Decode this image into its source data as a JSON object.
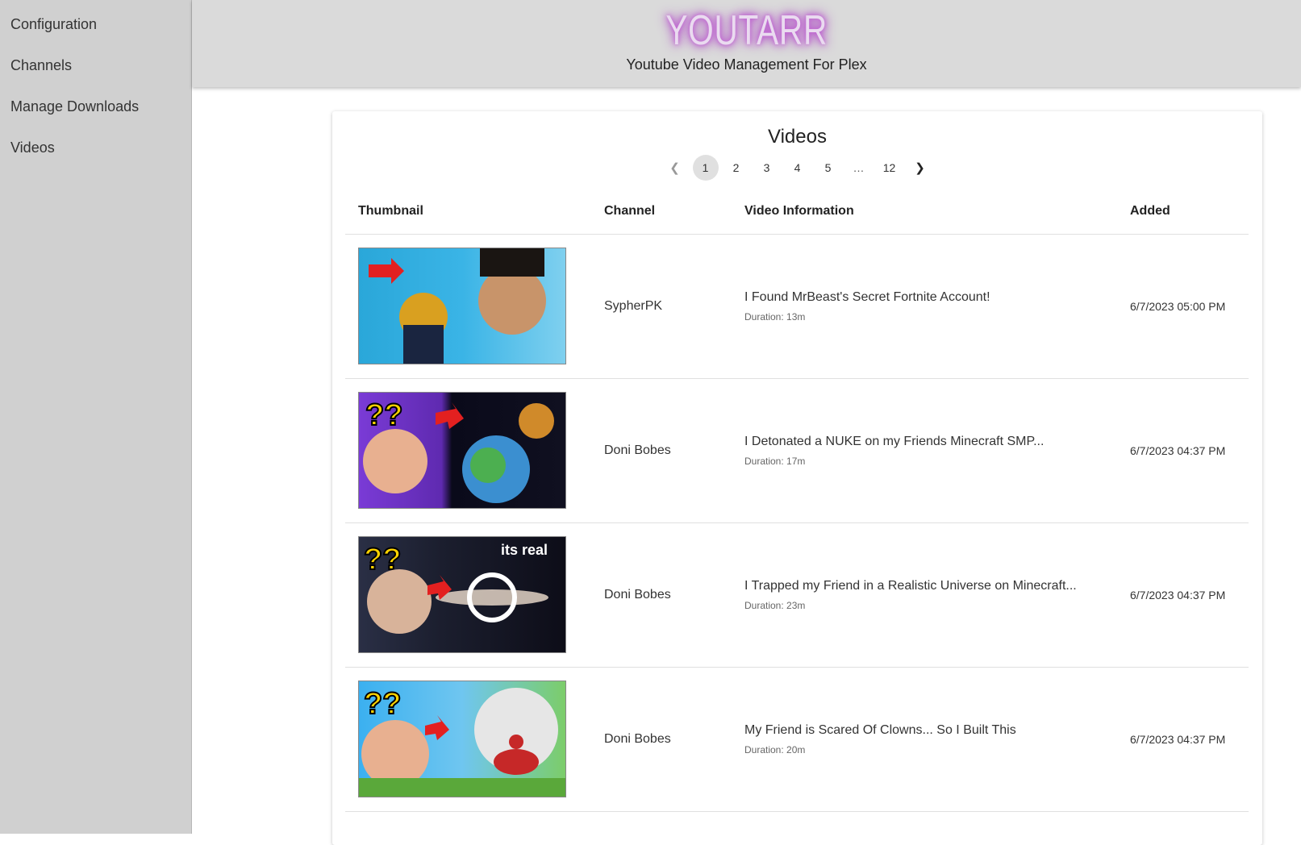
{
  "sidebar": {
    "items": [
      {
        "label": "Configuration"
      },
      {
        "label": "Channels"
      },
      {
        "label": "Manage Downloads"
      },
      {
        "label": "Videos"
      }
    ]
  },
  "header": {
    "brand": "YOUTARR",
    "tagline": "Youtube Video Management For Plex"
  },
  "videos": {
    "title": "Videos",
    "pagination": {
      "prev_icon": "chevron-left-icon",
      "next_icon": "chevron-right-icon",
      "pages": [
        "1",
        "2",
        "3",
        "4",
        "5",
        "…",
        "12"
      ],
      "current": "1"
    },
    "columns": [
      "Thumbnail",
      "Channel",
      "Video Information",
      "Added"
    ],
    "rows": [
      {
        "channel": "SypherPK",
        "title": "I Found MrBeast's Secret Fortnite Account!",
        "duration": "Duration: 13m",
        "added": "6/7/2023 05:00 PM",
        "thumb_text": ""
      },
      {
        "channel": "Doni Bobes",
        "title": "I Detonated a NUKE on my Friends Minecraft SMP...",
        "duration": "Duration: 17m",
        "added": "6/7/2023 04:37 PM",
        "thumb_text": ""
      },
      {
        "channel": "Doni Bobes",
        "title": "I Trapped my Friend in a Realistic Universe on Minecraft...",
        "duration": "Duration: 23m",
        "added": "6/7/2023 04:37 PM",
        "thumb_text": "its real"
      },
      {
        "channel": "Doni Bobes",
        "title": "My Friend is Scared Of Clowns... So I Built This",
        "duration": "Duration: 20m",
        "added": "6/7/2023 04:37 PM",
        "thumb_text": ""
      }
    ]
  }
}
